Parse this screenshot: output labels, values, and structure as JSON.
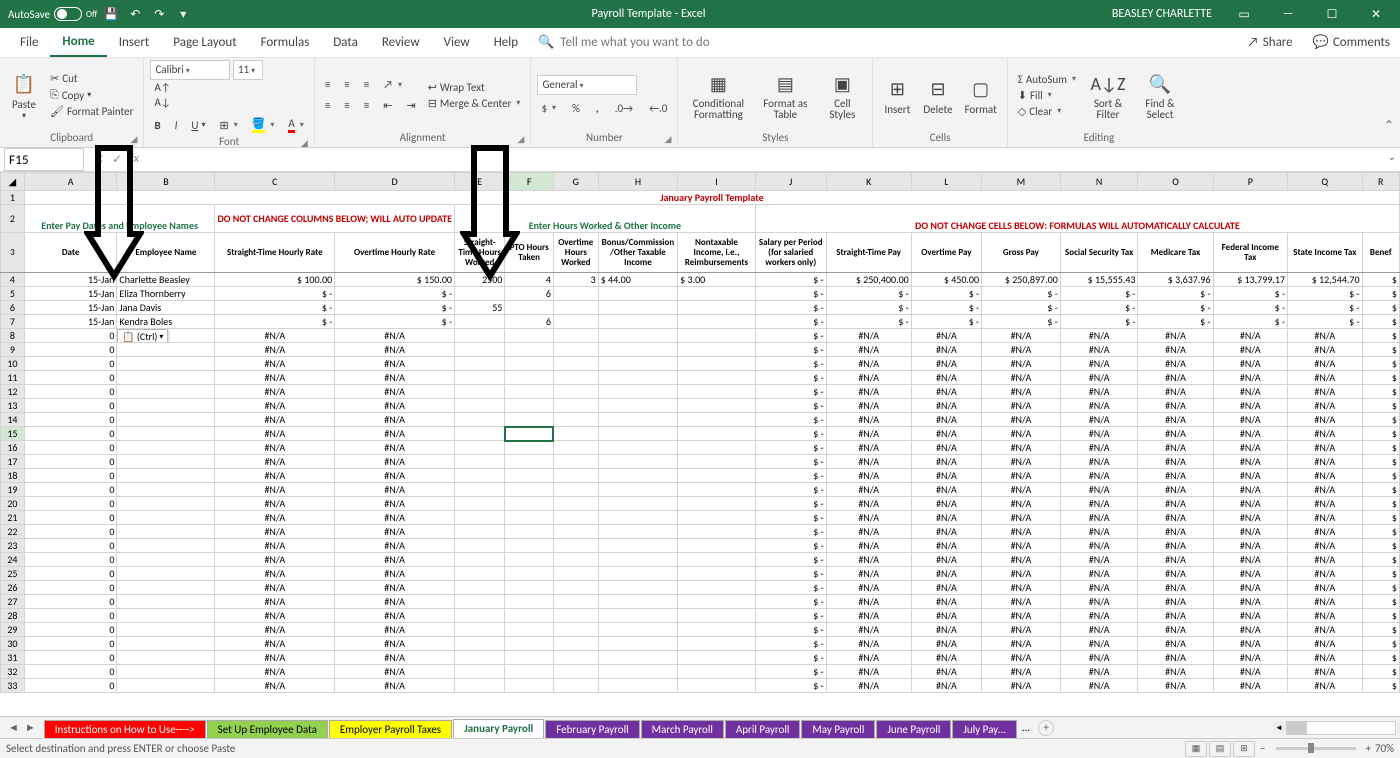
{
  "titlebar": {
    "autosave": "AutoSave",
    "autosave_state": "Off",
    "title": "Payroll Template  -  Excel",
    "user": "BEASLEY CHARLETTE"
  },
  "menu": {
    "file": "File",
    "home": "Home",
    "insert": "Insert",
    "page_layout": "Page Layout",
    "formulas": "Formulas",
    "data": "Data",
    "review": "Review",
    "view": "View",
    "help": "Help",
    "tell_me": "Tell me what you want to do",
    "share": "Share",
    "comments": "Comments"
  },
  "ribbon": {
    "paste": "Paste",
    "cut": "Cut",
    "copy": "Copy",
    "format_painter": "Format Painter",
    "clipboard": "Clipboard",
    "font_name": "Calibri",
    "font_size": "11",
    "font": "Font",
    "wrap": "Wrap Text",
    "merge": "Merge & Center",
    "alignment": "Alignment",
    "number_format": "General",
    "number": "Number",
    "cond_fmt": "Conditional Formatting",
    "fmt_table": "Format as Table",
    "cell_styles": "Cell Styles",
    "styles": "Styles",
    "insert": "Insert",
    "delete": "Delete",
    "format": "Format",
    "cells": "Cells",
    "autosum": "AutoSum",
    "fill": "Fill",
    "clear": "Clear",
    "sort_filter": "Sort & Filter",
    "find_select": "Find & Select",
    "editing": "Editing"
  },
  "formula_bar": {
    "name_box": "F15",
    "formula": ""
  },
  "sheet_header": {
    "title": "January Payroll Template",
    "enter_names": "Enter Pay Dates and Employee Names",
    "do_not_change_1": "DO NOT CHANGE COLUMNS BELOW; WILL AUTO UPDATE",
    "enter_hours": "Enter Hours Worked & Other Income",
    "do_not_change_2": "DO NOT CHANGE CELLS BELOW: FORMULAS WILL AUTOMATICALLY CALCULATE"
  },
  "col_headers": {
    "A": "Date",
    "B": "Employee Name",
    "C": "Straight-Time Hourly Rate",
    "D": "Overtime Hourly Rate",
    "E": "Straight-Time Hours Worked",
    "F": "PTO Hours Taken",
    "G": "Overtime Hours Worked",
    "H": "Bonus/Commission /Other Taxable Income",
    "I": "Nontaxable Income, i.e., Reimbursements",
    "J": "Salary per Period (for salaried workers only)",
    "K": "Straight-Time Pay",
    "L": "Overtime Pay",
    "M": "Gross Pay",
    "N": "Social Security Tax",
    "O": "Medicare Tax",
    "P": "Federal Income Tax",
    "Q": "State Income Tax",
    "R": "Benef"
  },
  "rows": [
    {
      "n": 4,
      "A": "15-Jan",
      "B": "Charlette Beasley",
      "C": "$    100.00",
      "D": "$    150.00",
      "E": "2500",
      "F": "4",
      "G": "3",
      "H": "$             44.00",
      "I": "$                3.00",
      "J": "$                     -",
      "K": "$              250,400.00",
      "L": "$              450.00",
      "M": "$       250,897.00",
      "N": "$         15,555.43",
      "O": "$           3,637.96",
      "P": "$        13,799.17",
      "Q": "$        12,544.70",
      "R": "$"
    },
    {
      "n": 5,
      "A": "15-Jan",
      "B": "Eliza Thornberry",
      "C": "$            -",
      "D": "$            -",
      "E": "",
      "F": "6",
      "G": "",
      "H": "",
      "I": "",
      "J": "$                     -",
      "K": "$                             -",
      "L": "$                     -",
      "M": "$                      -",
      "N": "$                      -",
      "O": "$                      -",
      "P": "$                     -",
      "Q": "$                     -",
      "R": "$"
    },
    {
      "n": 6,
      "A": "15-Jan",
      "B": "Jana Davis",
      "C": "$            -",
      "D": "$            -",
      "E": "55",
      "F": "",
      "G": "",
      "H": "",
      "I": "",
      "J": "$                     -",
      "K": "$                             -",
      "L": "$                     -",
      "M": "$                      -",
      "N": "$                      -",
      "O": "$                      -",
      "P": "$                     -",
      "Q": "$                     -",
      "R": "$"
    },
    {
      "n": 7,
      "A": "15-Jan",
      "B": "Kendra Boles",
      "C": "$            -",
      "D": "$            -",
      "E": "",
      "F": "6",
      "G": "",
      "H": "",
      "I": "",
      "J": "$                     -",
      "K": "$                             -",
      "L": "$                     -",
      "M": "$                      -",
      "N": "$                      -",
      "O": "$                      -",
      "P": "$                     -",
      "Q": "$                     -",
      "R": "$"
    }
  ],
  "na_rows": {
    "start": 8,
    "end": 33,
    "A": "0",
    "C": "#N/A",
    "D": "#N/A",
    "dash": "$                     -",
    "na": "#N/A",
    "doll": "$"
  },
  "paste_tag": "(Ctrl)",
  "sheet_tabs": {
    "inst": "Instructions on How to Use---->",
    "setup": "Set Up Employee Data",
    "taxes": "Employer Payroll Taxes",
    "jan": "January Payroll",
    "feb": "February Payroll",
    "mar": "March Payroll",
    "apr": "April Payroll",
    "may": "May Payroll",
    "jun": "June Payroll",
    "jul": "July Pay…",
    "more": "..."
  },
  "status": {
    "msg": "Select destination and press ENTER or choose Paste",
    "zoom": "70%"
  }
}
